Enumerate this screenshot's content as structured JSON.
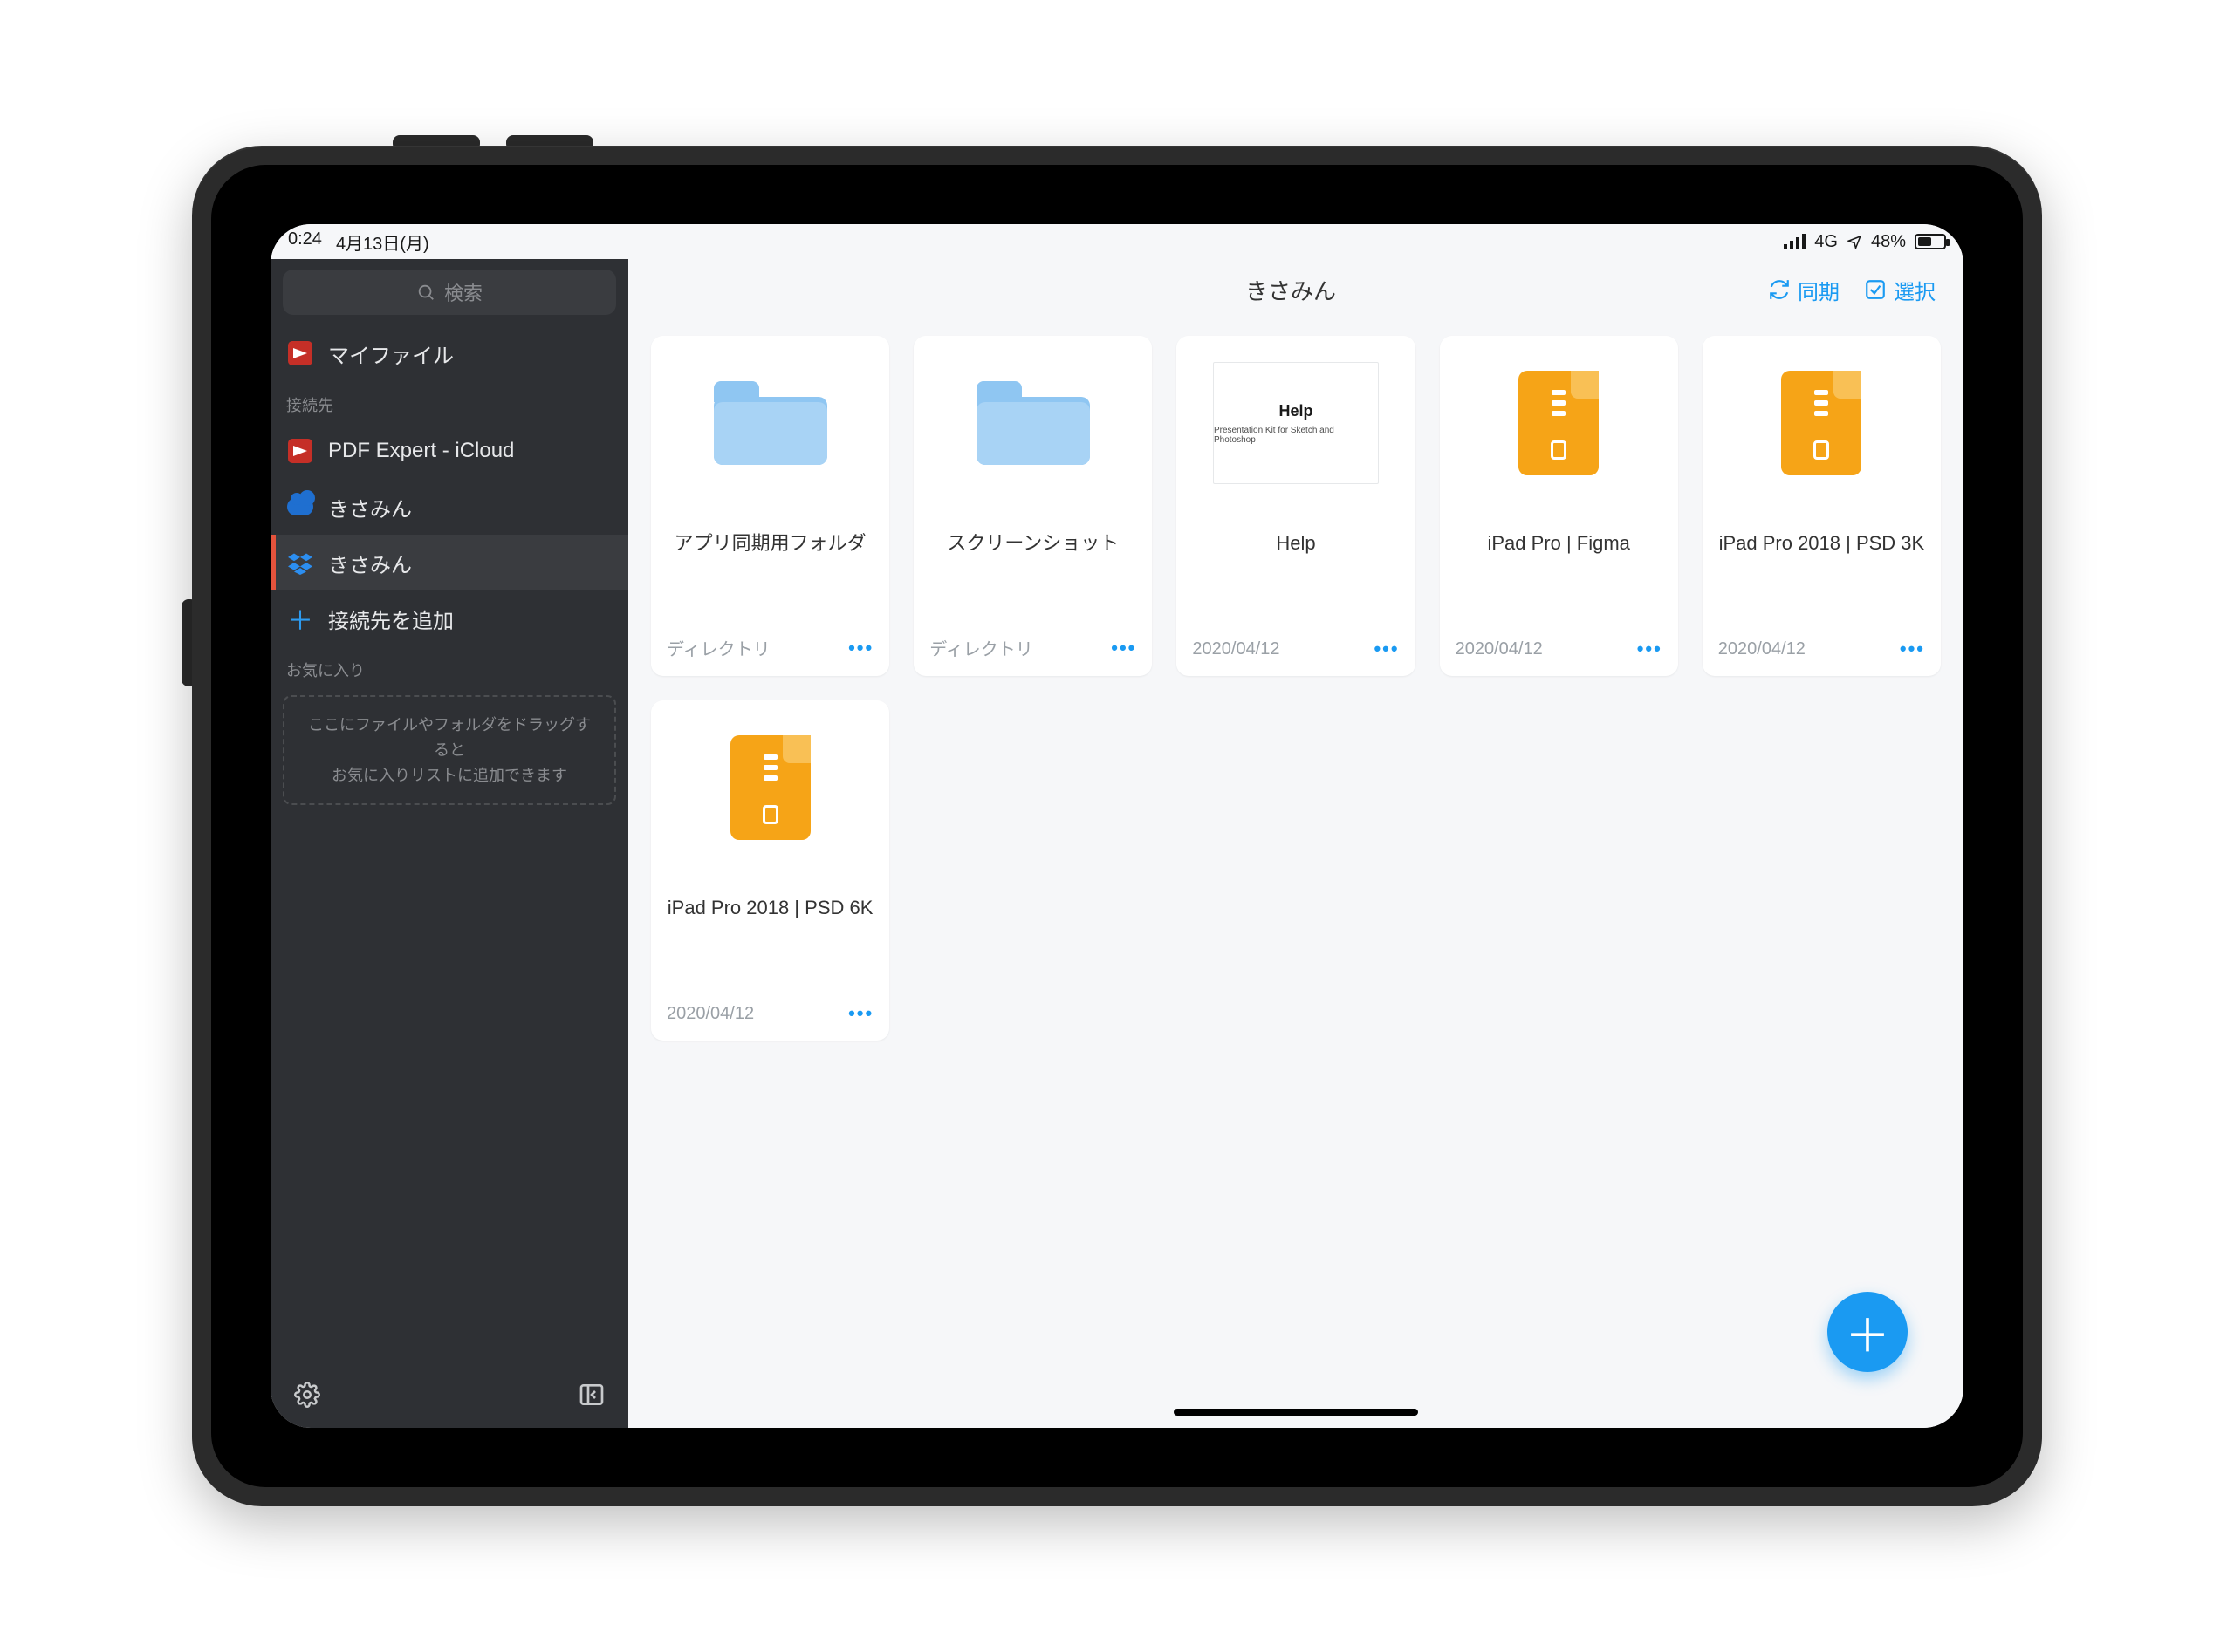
{
  "status": {
    "time": "0:24",
    "date": "4月13日(月)",
    "carrier": "4G",
    "battery_pct": "48%"
  },
  "sidebar": {
    "search_placeholder": "検索",
    "my_files_label": "マイファイル",
    "section_connections": "接続先",
    "items": [
      {
        "label": "PDF Expert - iCloud"
      },
      {
        "label": "きさみん"
      },
      {
        "label": "きさみん"
      }
    ],
    "add_connection_label": "接続先を追加",
    "section_favorites": "お気に入り",
    "favorites_hint": "ここにファイルやフォルダをドラッグすると\nお気に入りリストに追加できます"
  },
  "main": {
    "title": "きさみん",
    "sync_label": "同期",
    "select_label": "選択",
    "items": [
      {
        "name": "アプリ同期用フォルダ",
        "meta": "ディレクトリ",
        "kind": "folder"
      },
      {
        "name": "スクリーンショット",
        "meta": "ディレクトリ",
        "kind": "folder"
      },
      {
        "name": "Help",
        "meta": "2020/04/12",
        "kind": "doc",
        "doc_title": "Help",
        "doc_sub": "Presentation Kit for Sketch and Photoshop"
      },
      {
        "name": "iPad Pro | Figma",
        "meta": "2020/04/12",
        "kind": "zip"
      },
      {
        "name": "iPad Pro 2018 | PSD 3K",
        "meta": "2020/04/12",
        "kind": "zip"
      },
      {
        "name": "iPad Pro 2018 | PSD 6K",
        "meta": "2020/04/12",
        "kind": "zip"
      }
    ]
  },
  "colors": {
    "accent": "#1a9af2"
  }
}
